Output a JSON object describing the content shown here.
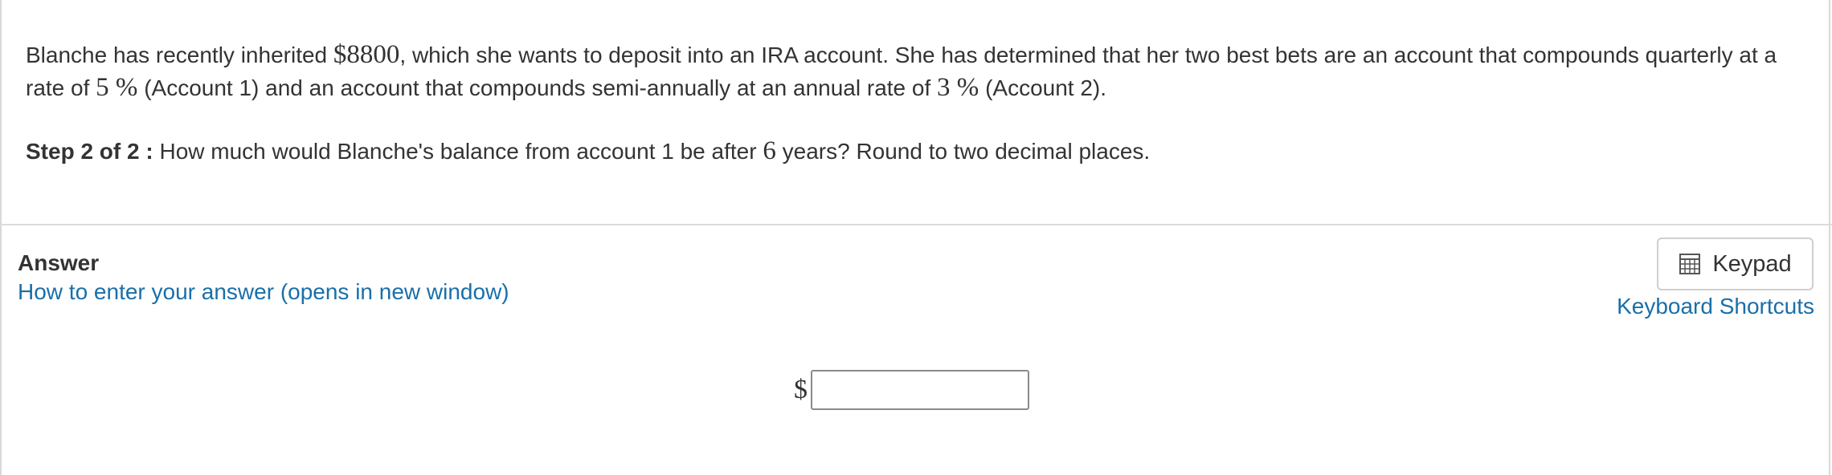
{
  "question": {
    "text_1": "Blanche has recently inherited ",
    "amount": "$8800",
    "text_2": ", which she wants to deposit into an IRA account.  She has determined that her two best bets are an account that compounds quarterly at a rate of ",
    "rate_1": "5 %",
    "text_3": "  (Account 1) and an account that compounds semi-annually at an annual rate of ",
    "rate_2": "3 %",
    "text_4": "  (Account 2)."
  },
  "step": {
    "label": "Step 2 of 2 :",
    "text_1": "  How much would Blanche's balance from account 1 be after ",
    "years": "6",
    "text_2": " years? Round to two decimal places."
  },
  "answer": {
    "title": "Answer",
    "help_link": "How to enter your answer (opens in new window)",
    "keypad_label": "Keypad",
    "shortcuts_link": "Keyboard Shortcuts",
    "currency_symbol": "$",
    "input_value": ""
  },
  "icons": {
    "keypad": "calculator-icon"
  },
  "colors": {
    "link": "#1a6fa8",
    "text": "#333333",
    "divider": "#dcdcdc"
  }
}
